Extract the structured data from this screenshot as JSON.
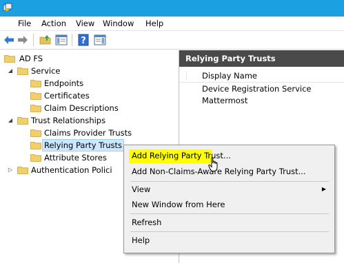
{
  "window": {
    "title_bar_color": "#1ba1e2",
    "app_icon": "mmc-console-icon"
  },
  "menubar": {
    "items": [
      "File",
      "Action",
      "View",
      "Window",
      "Help"
    ]
  },
  "toolbar": {
    "buttons": [
      "back-arrow-icon",
      "forward-arrow-icon",
      "up-folder-icon",
      "show-hide-tree-icon",
      "help-icon",
      "show-hide-action-pane-icon"
    ]
  },
  "tree": {
    "root": "AD FS",
    "service": "Service",
    "endpoints": "Endpoints",
    "certificates": "Certificates",
    "claim_descriptions": "Claim Descriptions",
    "trust_relationships": "Trust Relationships",
    "claims_provider_trusts": "Claims Provider Trusts",
    "relying_party_trusts": "Relying Party Trusts",
    "attribute_stores": "Attribute Stores",
    "authentication_policies": "Authentication Polici"
  },
  "right_pane": {
    "header": "Relying Party Trusts",
    "column_header": "Display Name",
    "rows": [
      "Device Registration Service",
      "Mattermost"
    ]
  },
  "context_menu": {
    "add_relying_party_trust": "Add Relying Party Trust...",
    "add_non_claims_aware": "Add Non-Claims-Aware Relying Party Trust...",
    "view": "View",
    "new_window": "New Window from Here",
    "refresh": "Refresh",
    "help": "Help",
    "highlight_color": "#ffff00"
  }
}
